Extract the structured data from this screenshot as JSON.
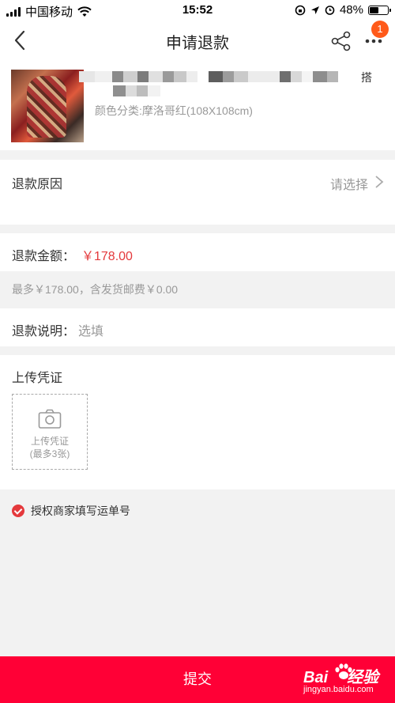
{
  "status_bar": {
    "carrier": "中国移动",
    "time": "15:52",
    "battery": "48%"
  },
  "nav": {
    "title": "申请退款",
    "badge_count": "1"
  },
  "product": {
    "title_visible_end": "搭",
    "sku": "颜色分类:摩洛哥红(108X108cm)"
  },
  "refund_reason": {
    "label": "退款原因",
    "placeholder": "请选择"
  },
  "refund_amount": {
    "label": "退款金额：",
    "value": "￥178.00"
  },
  "amount_note": "最多￥178.00，含发货邮费￥0.00",
  "refund_explain": {
    "label": "退款说明：",
    "placeholder": "选填"
  },
  "upload": {
    "label": "上传凭证",
    "box_line1": "上传凭证",
    "box_line2": "(最多3张)"
  },
  "authorize": {
    "label": "授权商家填写运单号",
    "checked": true
  },
  "submit_label": "提交",
  "watermark": {
    "brand_a": "Bai",
    "brand_b": "经验",
    "url": "jingyan.baidu.com"
  },
  "colors": {
    "accent": "#ff0036",
    "price": "#e4393c",
    "badge": "#ff5a1a"
  }
}
